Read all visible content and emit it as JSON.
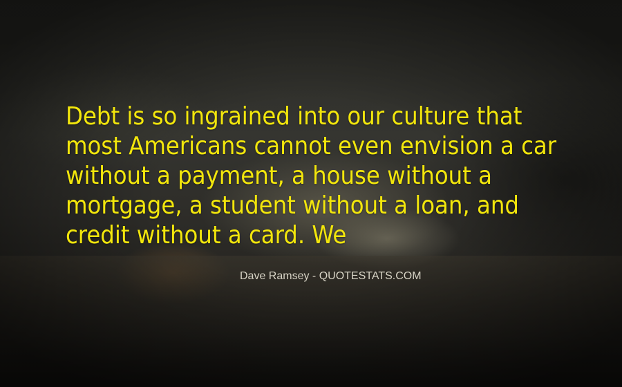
{
  "quote": {
    "lines": [
      "Debt is so ingrained into our culture that",
      "most Americans cannot even envision a car",
      "without a payment, a house without a",
      "mortgage, a student without a loan, and",
      "credit without a card. We"
    ]
  },
  "attribution": {
    "author": "Dave Ramsey",
    "separator": " - ",
    "source": "QUOTESTATS.COM"
  },
  "colors": {
    "quote_text": "#f2e60c",
    "attribution_text": "#d8d4c6"
  }
}
